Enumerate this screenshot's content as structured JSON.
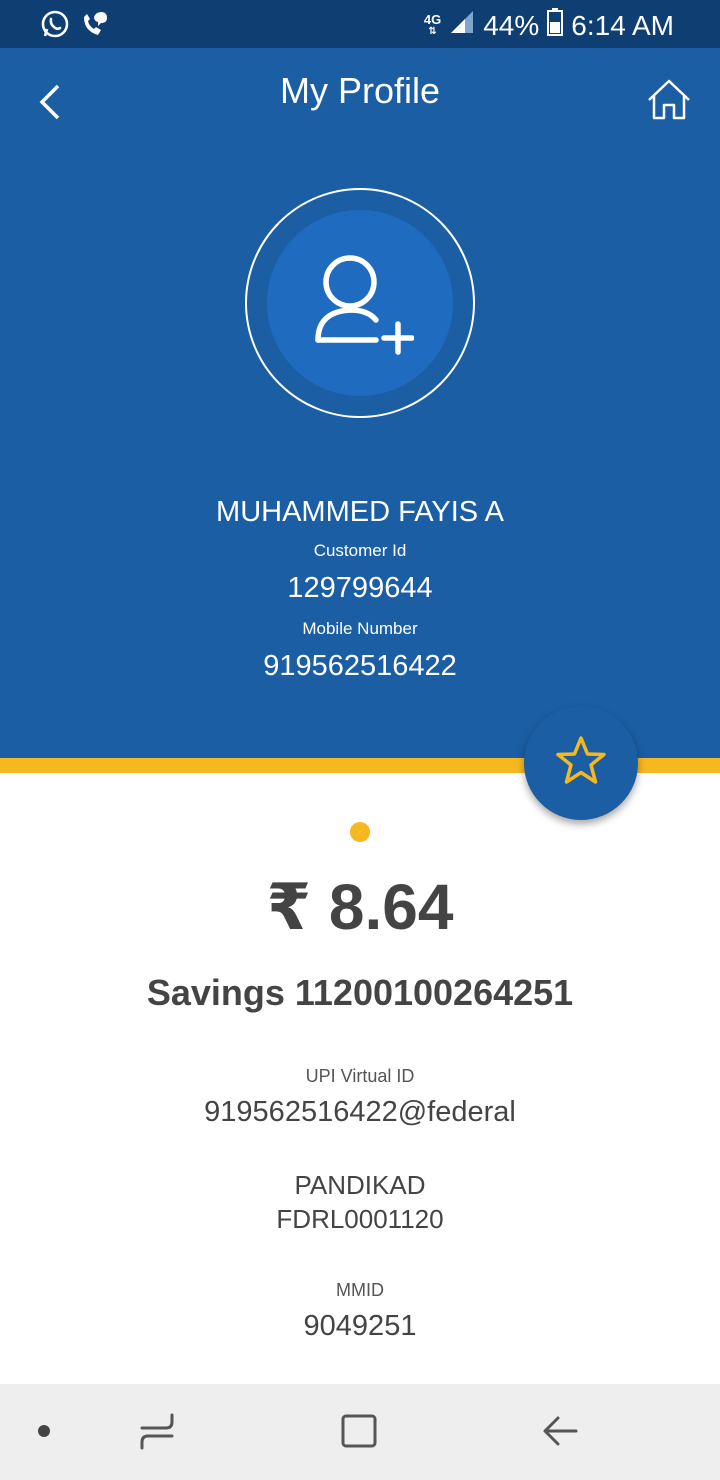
{
  "status_bar": {
    "network_type": "4G",
    "battery": "44%",
    "time": "6:14 AM",
    "icons": [
      "whatsapp-icon",
      "missed-call-icon",
      "data-arrows-icon",
      "signal-icon",
      "battery-icon"
    ]
  },
  "header": {
    "title": "My Profile",
    "back_icon": "chevron-left-icon",
    "home_icon": "home-icon"
  },
  "profile": {
    "avatar_icon": "add-user-icon",
    "name": "MUHAMMED FAYIS A",
    "customer_id_label": "Customer Id",
    "customer_id": "129799644",
    "mobile_label": "Mobile Number",
    "mobile": "919562516422"
  },
  "favorite_icon": "star-icon",
  "account": {
    "balance": "₹ 8.64",
    "account_line": "Savings 11200100264251",
    "upi_label": "UPI Virtual ID",
    "upi_id": "919562516422@federal",
    "branch": "PANDIKAD",
    "ifsc": "FDRL0001120",
    "mmid_label": "MMID",
    "mmid": "9049251"
  },
  "nav_bar": {
    "icons": [
      "dot-icon",
      "recent-apps-icon",
      "home-square-icon",
      "back-arrow-icon"
    ]
  },
  "colors": {
    "status_bar": "#0f3e73",
    "header": "#1b5ea3",
    "accent": "#f5b91f",
    "avatar_fill": "#1f6bbf",
    "text_dark": "#444444"
  }
}
